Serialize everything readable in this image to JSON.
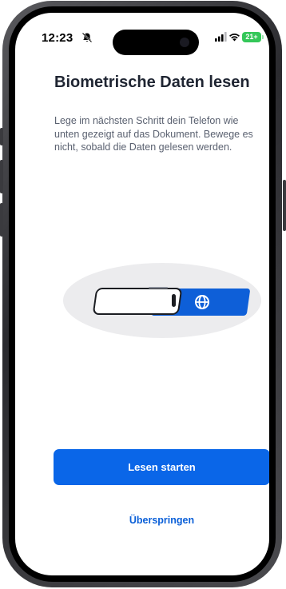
{
  "status_bar": {
    "time": "12:23",
    "battery": "21+",
    "icons": [
      "bell-slash-icon",
      "signal-icon",
      "wifi-icon",
      "battery-icon"
    ]
  },
  "screen": {
    "title": "Biometrische Daten lesen",
    "description": "Lege im nächsten Schritt dein Telefon wie unten gezeigt auf das Dokument. Bewege es nicht, sobald die Daten gelesen werden.",
    "illustration_icons": [
      "phone-icon",
      "document-card-icon",
      "globe-icon"
    ],
    "primary_button_label": "Lesen starten",
    "secondary_button_label": "Überspringen"
  },
  "colors": {
    "primary": "#0a66e8",
    "title": "#1f2532",
    "body_text": "#5a6170",
    "battery": "#34c759"
  }
}
